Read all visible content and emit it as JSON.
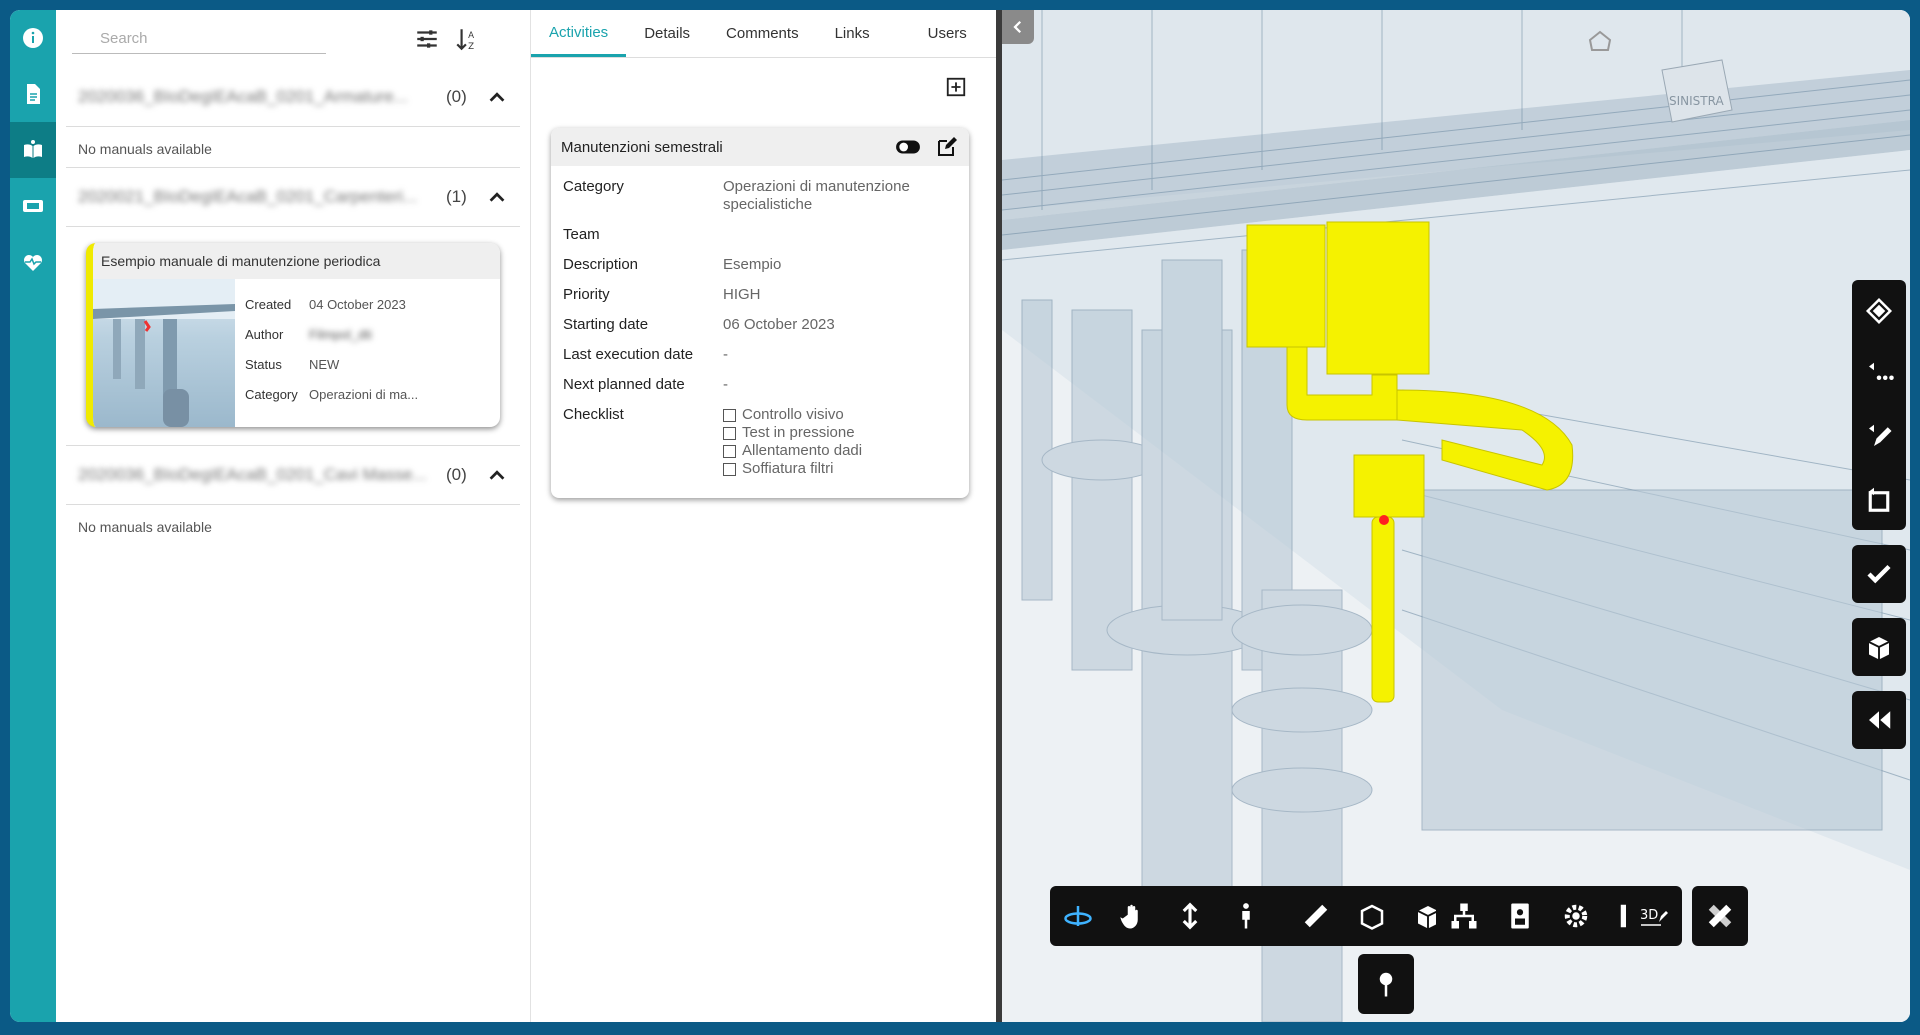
{
  "search": {
    "placeholder": "Search"
  },
  "groups": [
    {
      "name": "2020036_BIoDegIEAcaB_0201_Armature...",
      "count": "(0)",
      "empty_text": "No manuals available"
    },
    {
      "name": "2020021_BIoDegIEAcaB_0201_Carpenteri...",
      "count": "(1)"
    },
    {
      "name": "2020036_BIoDegIEAcaB_0201_Cavi Masse...",
      "count": "(0)",
      "empty_text": "No manuals available"
    }
  ],
  "manual_card": {
    "title": "Esempio manuale di manutenzione periodica",
    "created_label": "Created",
    "created_value": "04 October 2023",
    "author_label": "Author",
    "author_value": "Filmpol_dti",
    "status_label": "Status",
    "status_value": "NEW",
    "category_label": "Category",
    "category_value": "Operazioni di ma..."
  },
  "tabs": [
    "Activities",
    "Details",
    "Comments",
    "Links",
    "Users"
  ],
  "activity": {
    "title": "Manutenzioni semestrali",
    "rows": [
      {
        "label": "Category",
        "value": "Operazioni di manutenzione specialistiche"
      },
      {
        "label": "Team",
        "value": ""
      },
      {
        "label": "Description",
        "value": "Esempio"
      },
      {
        "label": "Priority",
        "value": "HIGH"
      },
      {
        "label": "Starting date",
        "value": "06 October 2023"
      },
      {
        "label": "Last execution date",
        "value": "-"
      },
      {
        "label": "Next planned date",
        "value": "-"
      }
    ],
    "checklist_label": "Checklist",
    "checklist": [
      "Controllo visivo",
      "Test in pressione",
      "Allentamento dadi",
      "Soffiatura filtri"
    ]
  },
  "viewer": {
    "cube_label": "SINISTRA",
    "tool_3d_label": "3D"
  },
  "colors": {
    "accent": "#1aa3ad",
    "highlight": "#f0ea00",
    "frame": "#0b5a86"
  }
}
